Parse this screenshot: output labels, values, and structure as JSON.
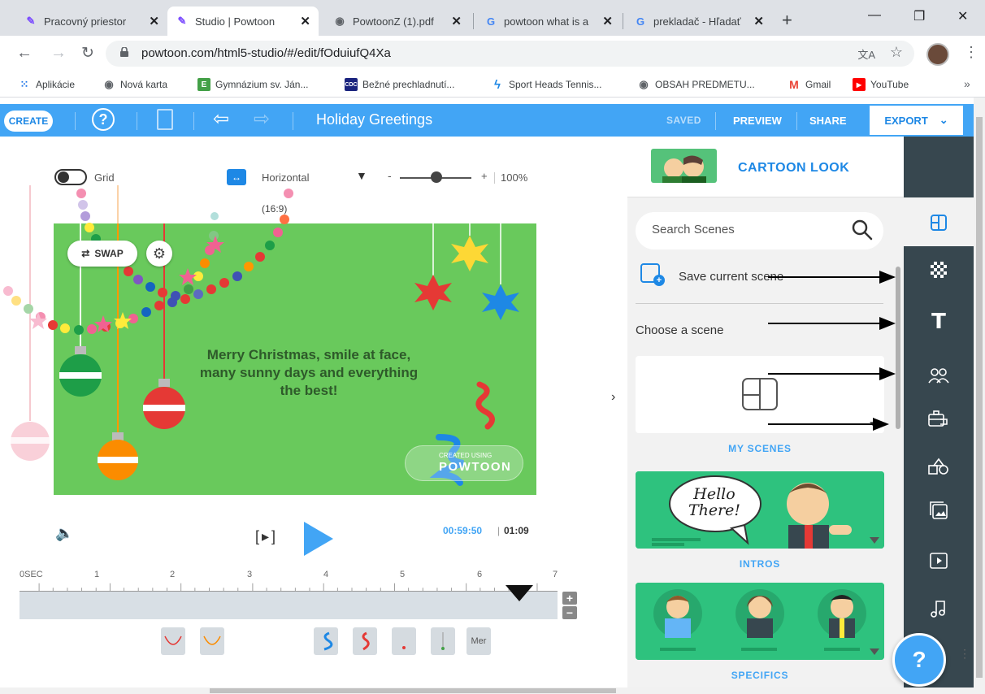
{
  "browser": {
    "tabs": [
      {
        "title": "Pracovný priestor",
        "icon": "powtoon-icon",
        "active": false
      },
      {
        "title": "Studio | Powtoon",
        "icon": "powtoon-icon",
        "active": true
      },
      {
        "title": "PowtoonZ (1).pdf",
        "icon": "globe-icon",
        "active": false
      },
      {
        "title": "powtoon what is a",
        "icon": "google-icon",
        "active": false
      },
      {
        "title": "prekladač - Hľadať",
        "icon": "google-icon",
        "active": false
      }
    ],
    "url": "powtoon.com/html5-studio/#/edit/fOduiufQ4Xa",
    "bookmarks": [
      {
        "label": "Aplikácie",
        "icon": "apps-grid-icon"
      },
      {
        "label": "Nová karta",
        "icon": "globe-icon"
      },
      {
        "label": "Gymnázium sv. Ján...",
        "icon": "gymnazium-icon"
      },
      {
        "label": "Bežné prechladnutí...",
        "icon": "cdc-icon"
      },
      {
        "label": "Sport Heads Tennis...",
        "icon": "sport-heads-icon"
      },
      {
        "label": "OBSAH PREDMETU...",
        "icon": "globe-icon"
      },
      {
        "label": "Gmail",
        "icon": "gmail-icon"
      },
      {
        "label": "YouTube",
        "icon": "youtube-icon"
      }
    ],
    "bookmarks_more": "»"
  },
  "topbar": {
    "create_label": "CREATE",
    "title": "Holiday Greetings",
    "saved_label": "SAVED",
    "preview_label": "PREVIEW",
    "share_label": "SHARE",
    "export_label": "EXPORT"
  },
  "canvas": {
    "grid_label": "Grid",
    "grid_on": false,
    "orientation_label": "Horizontal",
    "ratio_label": "(16:9)",
    "zoom_minus": "-",
    "zoom_plus": "+",
    "zoom_value": "100%",
    "swap_label": "SWAP",
    "scene_text": "Merry Christmas, smile at face, many sunny days and everything the best!",
    "watermark_small": "CREATED USING",
    "watermark_big": "POWTOON"
  },
  "playback": {
    "current_time": "00:59:50",
    "separator": "|",
    "total_time": "01:09",
    "frame_label": "[▸]"
  },
  "timeline": {
    "ticks": [
      "0SEC",
      "1",
      "2",
      "3",
      "4",
      "5",
      "6",
      "7"
    ],
    "thumbnails": [
      {
        "kind": "garland-red"
      },
      {
        "kind": "garland-orange"
      },
      {
        "kind": "ribbon-blue"
      },
      {
        "kind": "ribbon-red"
      },
      {
        "kind": "ornament-small"
      },
      {
        "kind": "ornament-line"
      },
      {
        "kind": "text",
        "label": "Mer"
      }
    ],
    "plus": "+",
    "minus": "−"
  },
  "panel": {
    "look_label": "CARTOON LOOK",
    "search_placeholder": "Search Scenes",
    "save_scene_label": "Save current scene",
    "choose_label": "Choose a scene",
    "categories": [
      {
        "label": "MY SCENES"
      },
      {
        "label": "INTROS",
        "bubble": "Hello There!"
      },
      {
        "label": "SPECIFICS"
      }
    ]
  },
  "sidebar_icons": [
    "layout-icon",
    "background-icon",
    "text-icon",
    "characters-icon",
    "props-icon",
    "shapes-icon",
    "media-icon",
    "video-icon",
    "music-icon"
  ],
  "help_fab": "?",
  "colors": {
    "accent": "#42a5f5",
    "scene_green": "#69c95c",
    "sidebar_dark": "#37474f"
  }
}
